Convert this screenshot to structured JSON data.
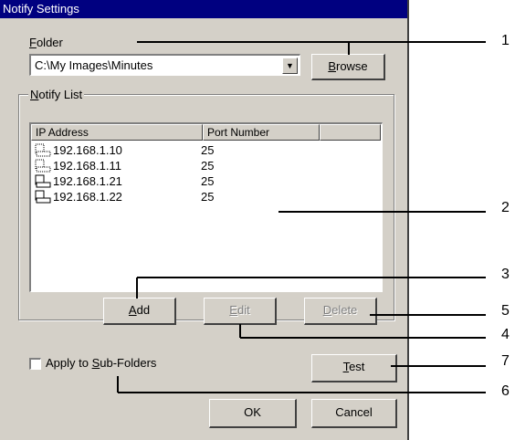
{
  "window": {
    "title": "Notify Settings"
  },
  "folder": {
    "label_mnemonic": "F",
    "label_rest": "older",
    "path_value": "C:\\My Images\\Minutes",
    "browse_mnemonic": "B",
    "browse_rest": "rowse"
  },
  "notify_list": {
    "group_mnemonic": "N",
    "group_rest": "otify List",
    "columns": [
      "IP Address",
      "Port Number"
    ],
    "rows": [
      {
        "ip": "192.168.1.10",
        "port": "25",
        "icon": "network-pc-icon"
      },
      {
        "ip": "192.168.1.11",
        "port": "25",
        "icon": "network-pc-icon"
      },
      {
        "ip": "192.168.1.21",
        "port": "25",
        "icon": "network-pc-icon"
      },
      {
        "ip": "192.168.1.22",
        "port": "25",
        "icon": "network-pc-icon"
      }
    ],
    "add_mnemonic": "A",
    "add_rest": "dd",
    "edit_mnemonic": "E",
    "edit_rest": "dit",
    "delete_mnemonic": "D",
    "delete_rest": "elete"
  },
  "apply_subfolders": {
    "label_before": "Apply to ",
    "label_mnemonic": "S",
    "label_rest": "ub-Folders",
    "checked": false
  },
  "test_button": {
    "mnemonic": "T",
    "rest": "est"
  },
  "ok_button": "OK",
  "cancel_button": "Cancel",
  "callouts": [
    "1",
    "2",
    "3",
    "4",
    "5",
    "6",
    "7"
  ]
}
